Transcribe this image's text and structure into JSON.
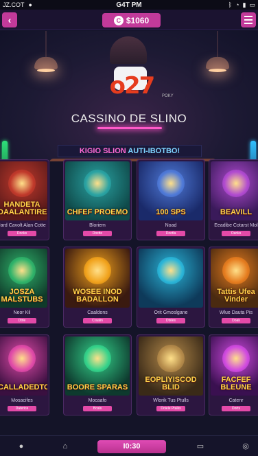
{
  "status_bar": {
    "left_text": "JZ.COT",
    "time": "G4T PM"
  },
  "top_bar": {
    "balance": "$1060",
    "balance_coin_glyph": "C"
  },
  "hero": {
    "logo_number": "o27",
    "logo_small": "POKY",
    "title": "CASSINO DE SLINO"
  },
  "section": {
    "part1": "KIGIO SLION ",
    "part2": "AUTI-IBOTBO!"
  },
  "games": [
    {
      "art_title": "HANDETA DAALANTIRES",
      "name": "Jard Cavolt Alan Cotte",
      "chip": "Dooks",
      "theme": "red"
    },
    {
      "art_title": "CHFEF PROEMO",
      "name": "Bloriem",
      "chip": "Dostte",
      "theme": "teal"
    },
    {
      "art_title": "100 SPS",
      "name": "Noad",
      "chip": "Dootla",
      "theme": "blue"
    },
    {
      "art_title": "BEAVILL",
      "name": "Eeadibe Cotarst Mol",
      "chip": "Oanks",
      "theme": "purple"
    },
    {
      "art_title": "JOSZA MALSTUBS",
      "name": "Neor Kil",
      "chip": "Dtrle",
      "theme": "green"
    },
    {
      "art_title": "WOSEE INOD BADALLON",
      "name": "Caaldons",
      "chip": "Craalin",
      "theme": "gold"
    },
    {
      "art_title": "",
      "name": "Orit Gmoslgane",
      "chip": "Dtsles",
      "theme": "cyan"
    },
    {
      "art_title": "Tattis Ufea Vinder",
      "name": "Wlue Dauta Pis",
      "chip": "Doak",
      "theme": "orange"
    },
    {
      "art_title": "CALLADEDTOS",
      "name": "Mosacifes",
      "chip": "Daterice",
      "theme": "pink"
    },
    {
      "art_title": "BOORE SPARAS",
      "name": "Mocaafo",
      "chip": "Bcals",
      "theme": "emerald"
    },
    {
      "art_title": "EOPLIYISCOD BLID",
      "name": "Wlorik Tus Ptulls",
      "chip": "Doiele Ptalks",
      "theme": "bronze"
    },
    {
      "art_title": "FACFEF BLEUNE",
      "name": "Catenr",
      "chip": "Dorts",
      "theme": "magenta"
    }
  ],
  "bottom_bar": {
    "center_label": "I0:30"
  },
  "colors": {
    "accent": "#c23a9a",
    "background": "#141428",
    "card": "#2c1640"
  }
}
